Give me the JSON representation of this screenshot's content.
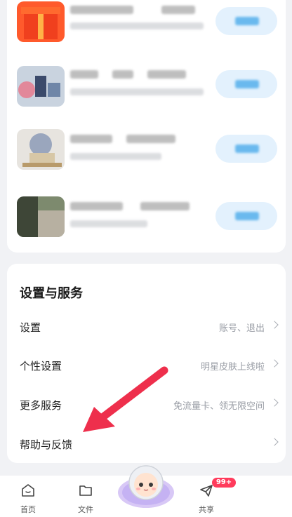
{
  "settings": {
    "title": "设置与服务",
    "items": [
      {
        "label": "设置",
        "hint": "账号、退出"
      },
      {
        "label": "个性设置",
        "hint": "明星皮肤上线啦"
      },
      {
        "label": "更多服务",
        "hint": "免流量卡、领无限空间"
      },
      {
        "label": "帮助与反馈",
        "hint": ""
      }
    ]
  },
  "tabbar": {
    "home": "首页",
    "files": "文件",
    "share": "共享",
    "share_badge": "99+"
  },
  "colors": {
    "accent_arrow": "#ee2f4c",
    "badge": "#ff3b5c",
    "promo_button": "#e3f1fd"
  }
}
